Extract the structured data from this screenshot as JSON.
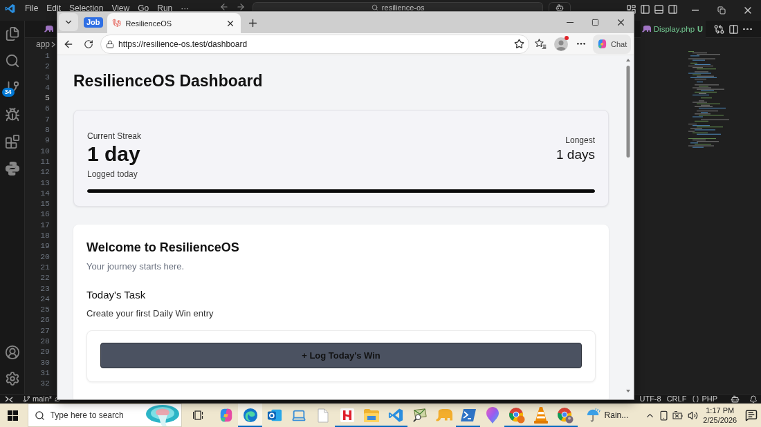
{
  "vscode": {
    "menu": [
      "File",
      "Edit",
      "Selection",
      "View",
      "Go",
      "Run",
      "···"
    ],
    "search": "resilience-os",
    "source_control_badge": "34",
    "breadcrumb": "app",
    "editor_tab": {
      "label": "Display.php",
      "git_status": "U"
    },
    "line_numbers": [
      {
        "number": "1",
        "current": false
      },
      {
        "number": "2",
        "current": false
      },
      {
        "number": "3",
        "current": false
      },
      {
        "number": "4",
        "current": false
      },
      {
        "number": "5",
        "current": true
      },
      {
        "number": "6",
        "current": false
      },
      {
        "number": "7",
        "current": false
      },
      {
        "number": "8",
        "current": false
      },
      {
        "number": "9",
        "current": false
      },
      {
        "number": "10",
        "current": false
      },
      {
        "number": "11",
        "current": false
      },
      {
        "number": "12",
        "current": false
      },
      {
        "number": "13",
        "current": false
      },
      {
        "number": "14",
        "current": false
      },
      {
        "number": "15",
        "current": false
      },
      {
        "number": "16",
        "current": false
      },
      {
        "number": "17",
        "current": false
      },
      {
        "number": "18",
        "current": false
      },
      {
        "number": "19",
        "current": false
      },
      {
        "number": "20",
        "current": false
      },
      {
        "number": "21",
        "current": false
      },
      {
        "number": "22",
        "current": false
      },
      {
        "number": "23",
        "current": false
      },
      {
        "number": "24",
        "current": false
      },
      {
        "number": "25",
        "current": false
      },
      {
        "number": "26",
        "current": false
      },
      {
        "number": "27",
        "current": false
      },
      {
        "number": "28",
        "current": false
      },
      {
        "number": "29",
        "current": false
      },
      {
        "number": "30",
        "current": false
      },
      {
        "number": "31",
        "current": false
      },
      {
        "number": "32",
        "current": false
      }
    ],
    "status_bar": {
      "branch": "main*",
      "encoding": "UTF-8",
      "line_ending": "CRLF",
      "language": "PHP"
    }
  },
  "browser": {
    "tab_group": "Job",
    "tabs": [
      {
        "title": "ResilienceOS",
        "selected": true
      }
    ],
    "address": "https://resilience-os.test/dashboard",
    "chat_button": "Chat"
  },
  "page": {
    "title": "ResilienceOS Dashboard",
    "streak": {
      "label": "Current Streak",
      "value": "1 day",
      "note": "Logged today",
      "longest_label": "Longest",
      "longest_value": "1 days",
      "level": 1
    },
    "welcome": {
      "title": "Welcome to ResilienceOS",
      "subtitle": "Your journey starts here.",
      "task_heading": "Today's Task",
      "task": "Create your first Daily Win entry",
      "button": "+ Log Today's Win"
    }
  },
  "taskbar": {
    "search_placeholder": "Type here to search",
    "apps": [
      {
        "running": false,
        "active": false
      },
      {
        "running": true,
        "active": true
      },
      {
        "running": false,
        "active": false
      },
      {
        "running": false,
        "active": false
      },
      {
        "running": false,
        "active": false
      },
      {
        "running": true,
        "active": false
      },
      {
        "running": true,
        "active": false
      },
      {
        "running": true,
        "active": false
      },
      {
        "running": false,
        "active": false
      },
      {
        "running": false,
        "active": false
      },
      {
        "running": true,
        "active": false
      },
      {
        "running": false,
        "active": false
      },
      {
        "running": true,
        "active": false
      },
      {
        "running": true,
        "active": false
      },
      {
        "running": true,
        "active": false
      }
    ],
    "weather": "Rain...",
    "time": "1:17 PM",
    "date": "2/25/2026"
  }
}
